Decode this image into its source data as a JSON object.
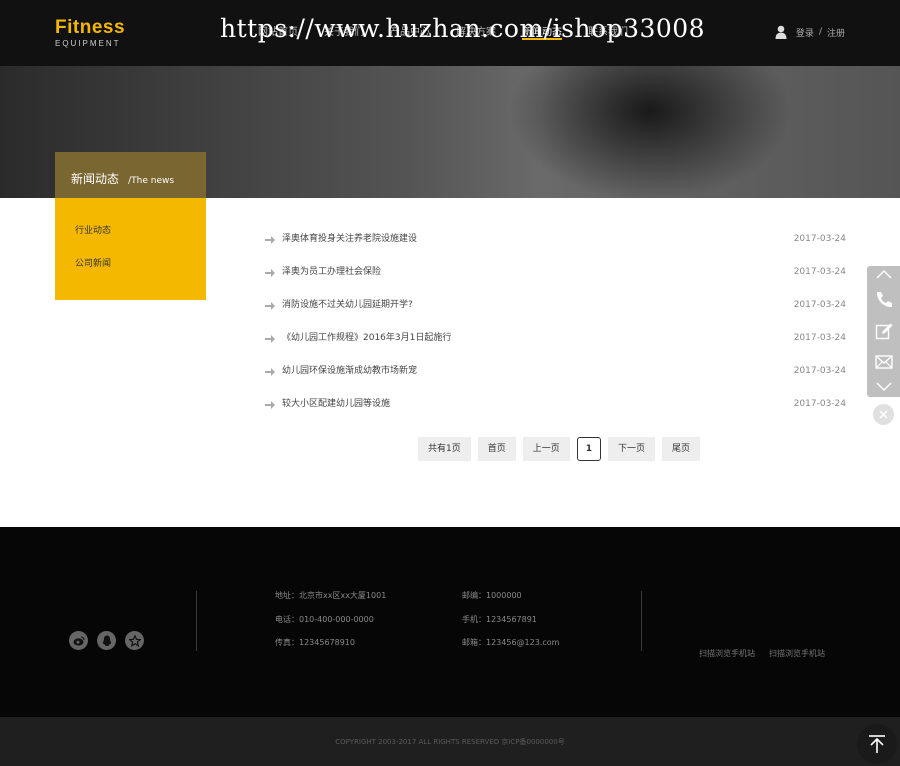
{
  "header": {
    "logo_main": "Fitness",
    "logo_sub": "EQUIPMENT",
    "nav": [
      "网站首页",
      "关于我们",
      "产品中心",
      "解决方案",
      "新闻动态",
      "联系我们"
    ],
    "active_nav_index": 4,
    "login": "登录",
    "separator": "/",
    "register": "注册"
  },
  "watermark": "https://www.huzhan.com/ishop33008",
  "sidebar": {
    "title_cn": "新闻动态",
    "title_en": "/The news",
    "items": [
      "行业动态",
      "公司新闻"
    ]
  },
  "news": [
    {
      "title": "泽奥体育投身关注养老院设施建设",
      "date": "2017-03-24"
    },
    {
      "title": "泽奥为员工办理社会保险",
      "date": "2017-03-24"
    },
    {
      "title": "消防设施不过关幼儿园延期开学?",
      "date": "2017-03-24"
    },
    {
      "title": "《幼儿园工作规程》2016年3月1日起施行",
      "date": "2017-03-24"
    },
    {
      "title": "幼儿园环保设施渐成幼教市场新宠",
      "date": "2017-03-24"
    },
    {
      "title": "较大小区配建幼儿园等设施",
      "date": "2017-03-24"
    }
  ],
  "pagination": {
    "total": "共有1页",
    "first": "首页",
    "prev": "上一页",
    "current": "1",
    "next": "下一页",
    "last": "尾页"
  },
  "float_bar": {
    "icons": [
      "chevron-up-icon",
      "phone-icon",
      "edit-icon",
      "mail-icon",
      "chevron-down-icon"
    ]
  },
  "footer": {
    "social_icons": [
      "weibo-icon",
      "qq-icon",
      "star-icon"
    ],
    "address": "地址：北京市xx区xx大厦1001",
    "phone": "电话：010-400-000-0000",
    "fax": "传真：12345678910",
    "postcode": "邮编：1000000",
    "mobile": "手机：1234567891",
    "email": "邮箱：123456@123.com",
    "qr_label_1": "扫描浏览手机站",
    "qr_label_2": "扫描浏览手机站"
  },
  "copyright": "COPYRIGHT 2003-2017 ALL RIGHTS RESERVED 京ICP备0000000号",
  "colors": {
    "accent": "#f5b800",
    "header_bg": "#111111",
    "footer_bg": "#060606",
    "copyright_bg": "#1f1f1f",
    "sidebar_title_bg": "#7a6631"
  }
}
